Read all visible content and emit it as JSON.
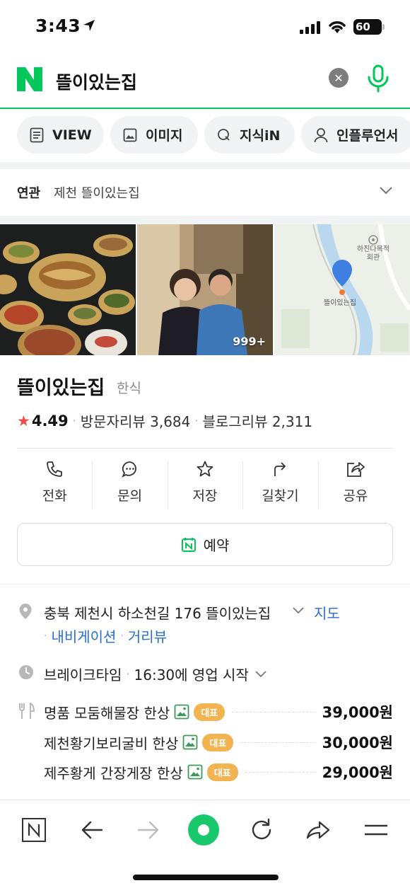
{
  "status": {
    "time": "3:43",
    "battery": "60"
  },
  "search": {
    "query": "뜰이있는집"
  },
  "tabs": [
    {
      "label": "VIEW"
    },
    {
      "label": "이미지"
    },
    {
      "label": "지식iN"
    },
    {
      "label": "인플루언서"
    }
  ],
  "related": {
    "tag": "연관",
    "text": "제천 뜰이있는집"
  },
  "photos": {
    "count_label": "999+",
    "map_labels": {
      "landmark": "하진다목적 회관",
      "place": "뜰이있는집"
    }
  },
  "place": {
    "name": "뜰이있는집",
    "category": "한식",
    "rating": "4.49",
    "visitor_reviews": "방문자리뷰 3,684",
    "blog_reviews": "블로그리뷰 2,311"
  },
  "actions": [
    {
      "label": "전화",
      "icon": "phone-icon"
    },
    {
      "label": "문의",
      "icon": "chat-icon"
    },
    {
      "label": "저장",
      "icon": "star-icon"
    },
    {
      "label": "길찾기",
      "icon": "directions-icon"
    },
    {
      "label": "공유",
      "icon": "share-icon"
    }
  ],
  "reserve": {
    "label": "예약"
  },
  "address": {
    "text": "충북 제천시 하소천길 176 뜰이있는집",
    "map_link": "지도",
    "nav_link": "내비게이션",
    "street_link": "거리뷰"
  },
  "hours": {
    "label": "브레이크타임",
    "detail": "16:30에 영업 시작"
  },
  "menu": [
    {
      "name": "명품 모둠해물장 한상",
      "badge": "대표",
      "price": "39,000원"
    },
    {
      "name": "제천황기보리굴비 한상",
      "badge": "대표",
      "price": "30,000원"
    },
    {
      "name": "제주황게 간장게장 한상",
      "badge": "대표",
      "price": "29,000원"
    }
  ],
  "colors": {
    "naver_green": "#03c75a",
    "link_blue": "#2a6ed6",
    "star_red": "#f24a4a",
    "badge_orange": "#f2b451"
  }
}
